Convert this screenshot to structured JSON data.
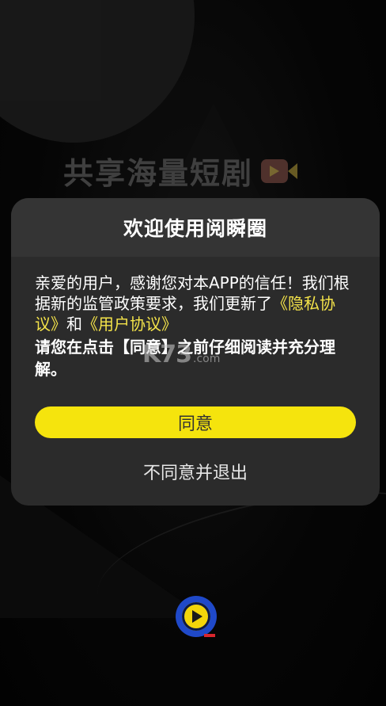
{
  "background": {
    "slogan": "共享海量短剧"
  },
  "dialog": {
    "title": "欢迎使用阅瞬圈",
    "body": {
      "intro": "亲爱的用户，感谢您对本APP的信任！我们根据新的监管政策要求，我们更新了",
      "privacy_link": "《隐私协议》",
      "conjunction": "和",
      "user_agreement_link": "《用户协议》",
      "notice": "请您在点击【同意】之前仔细阅读并充分理解。"
    },
    "agree_label": "同意",
    "decline_label": "不同意并退出"
  },
  "watermark": {
    "main": "K73",
    "sub": ".com"
  },
  "colors": {
    "accent": "#f5e40d",
    "link": "#f4e34a",
    "dialog_bg": "#2b2b2b",
    "dialog_header_bg": "#343434"
  }
}
